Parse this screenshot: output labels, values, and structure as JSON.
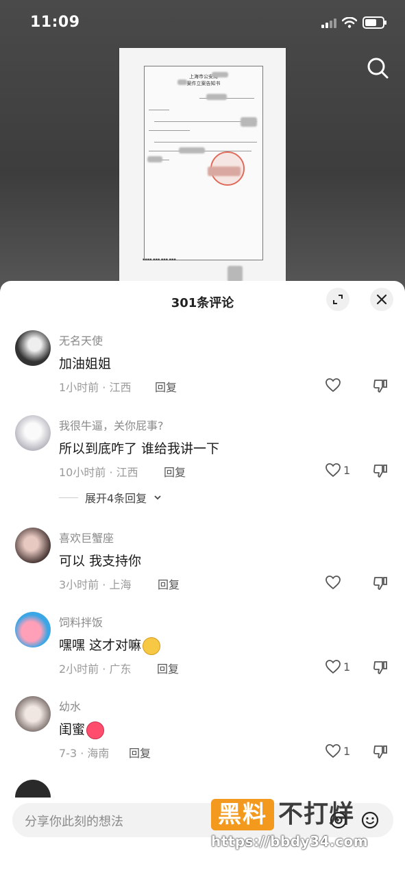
{
  "status": {
    "time": "11:09"
  },
  "document_preview": {
    "line1": "上海市公安局",
    "line2": "案件立案告知书"
  },
  "sheet": {
    "title": "301条评论"
  },
  "comments": [
    {
      "user": "无名天使",
      "text": "加油姐姐",
      "meta": "1小时前 · 江西",
      "reply": "回复",
      "likes": ""
    },
    {
      "user": "我很牛逼，关你屁事?",
      "text": "所以到底咋了 谁给我讲一下",
      "meta": "10小时前 · 江西",
      "reply": "回复",
      "likes": "1",
      "expand": "展开4条回复"
    },
    {
      "user": "喜欢巨蟹座",
      "text": "可以 我支持你",
      "meta": "3小时前 · 上海",
      "reply": "回复",
      "likes": ""
    },
    {
      "user": "饲料拌饭",
      "text": "嘿嘿 这才对嘛",
      "meta": "2小时前 · 广东",
      "reply": "回复",
      "likes": "1"
    },
    {
      "user": "幼水",
      "text": "闺蜜",
      "meta": "7-3 · 海南",
      "reply": "回复",
      "likes": "1"
    }
  ],
  "input": {
    "placeholder": "分享你此刻的想法"
  },
  "watermark": {
    "badge": "黑料",
    "text": "不打烊",
    "url": "https://bbdy34.com"
  },
  "colors": {
    "accent": "#f39a1e",
    "stamp": "#e06a5a"
  },
  "icons": [
    "search-icon",
    "expand-icon",
    "close-icon",
    "heart-icon",
    "dislike-icon",
    "at-icon",
    "emoji-icon"
  ]
}
